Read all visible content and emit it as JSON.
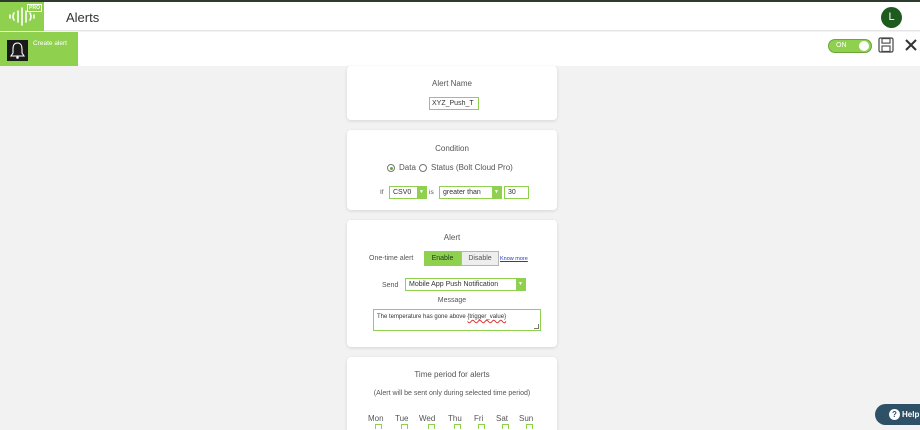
{
  "header": {
    "pro_badge": "PRO",
    "title": "Alerts",
    "avatar_initial": "L"
  },
  "toolbar": {
    "create_alert_label": "Create alert",
    "toggle_label": "ON",
    "toggle_state": "on"
  },
  "alert_name": {
    "title": "Alert Name",
    "value": "XYZ_Push_T"
  },
  "condition": {
    "title": "Condition",
    "options": [
      "Data",
      "Status (Bolt Cloud Pro)"
    ],
    "selected_option": "Data",
    "if_label": "If",
    "variable": "CSV0",
    "is_label": "is",
    "operator": "greater than",
    "threshold": "30"
  },
  "alert": {
    "title": "Alert",
    "one_time_label": "One-time alert",
    "enable_label": "Enable",
    "disable_label": "Disable",
    "selected": "Enable",
    "know_more": "Know more",
    "send_label": "Send",
    "send_value": "Mobile App Push Notification",
    "message_label": "Message",
    "message_prefix": "The temperature has gone above ",
    "message_token": "{trigger_value}"
  },
  "time_period": {
    "title": "Time period for alerts",
    "subtitle": "(Alert will be sent only during selected time period)",
    "days": [
      "Mon",
      "Tue",
      "Wed",
      "Thu",
      "Fri",
      "Sat",
      "Sun"
    ]
  },
  "help": {
    "label": "Help",
    "icon": "?"
  },
  "colors": {
    "accent": "#8fd14f",
    "avatar": "#1e5b1e",
    "help": "#2f5167"
  }
}
